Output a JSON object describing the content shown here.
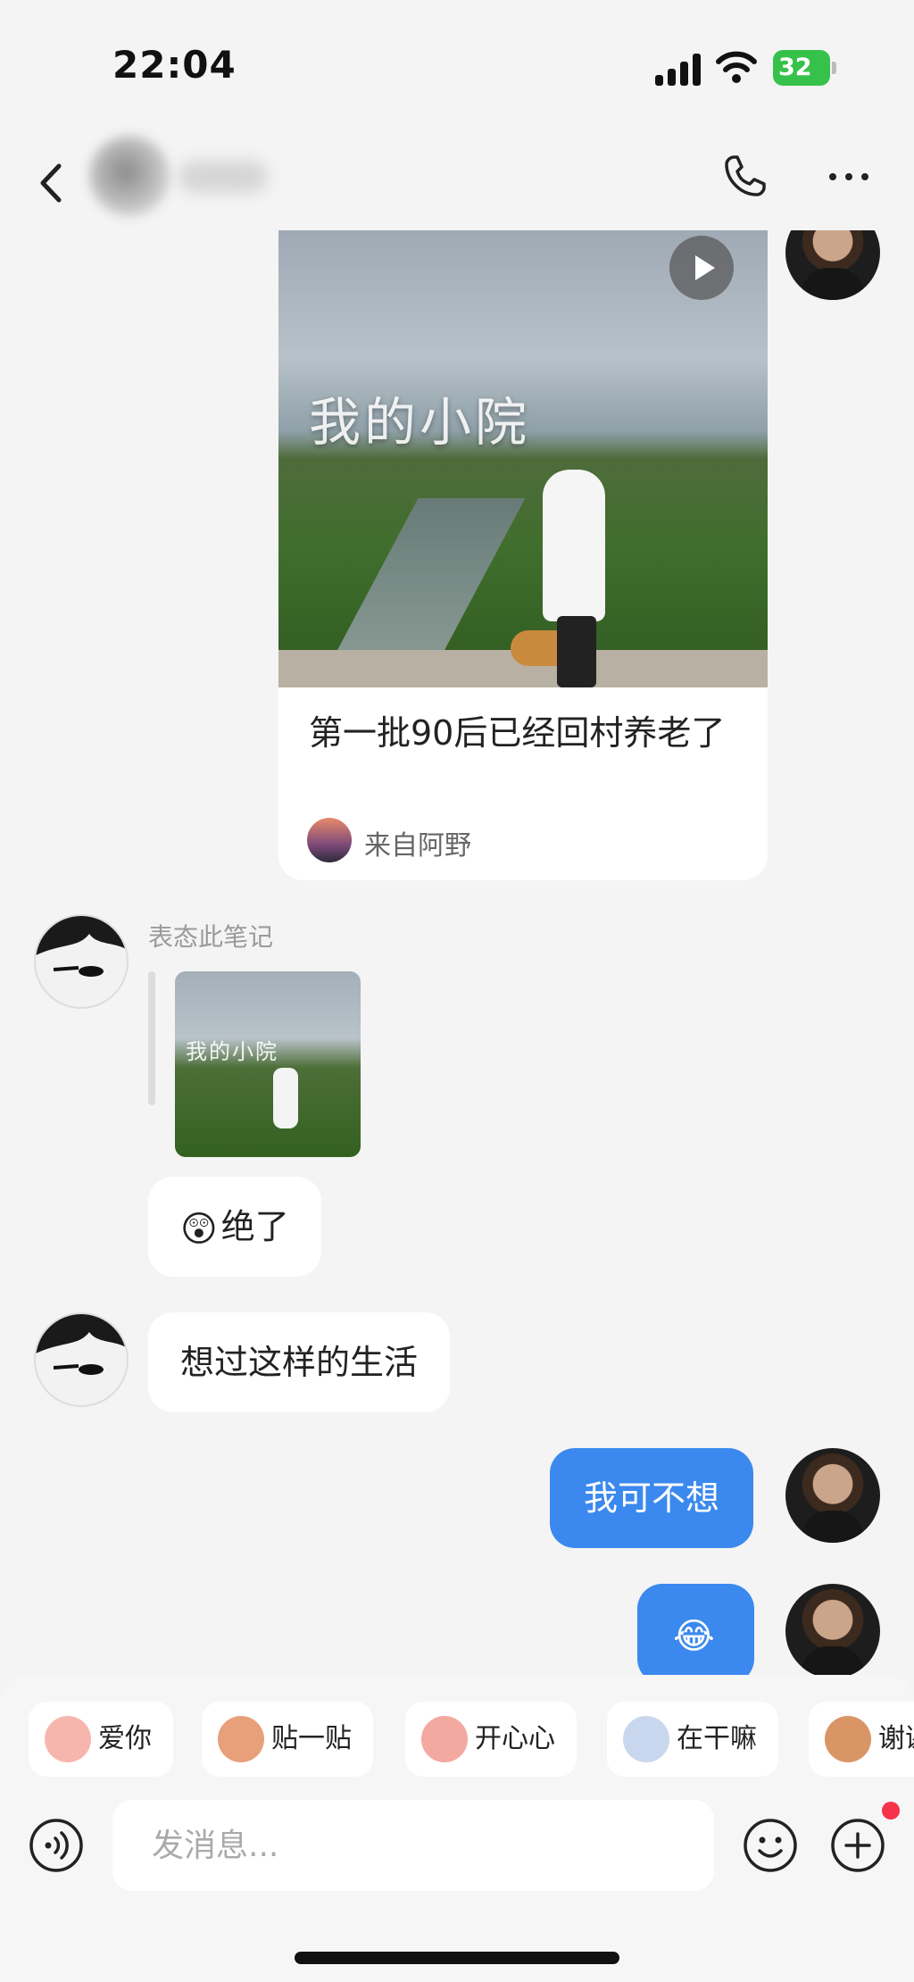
{
  "status_bar": {
    "time": "22:04",
    "battery": "32"
  },
  "card": {
    "image_title": "我的小院",
    "title": "第一批90后已经回村养老了",
    "source": "来自阿野"
  },
  "reaction": {
    "label": "表态此笔记",
    "thumb_title": "我的小院"
  },
  "messages": {
    "peer_emoji_text": "绝了",
    "peer_text": "想过这样的生活",
    "me_text": "我可不想",
    "me_emoji": "😂",
    "peer_emoji_glyph": "😲"
  },
  "stickers": [
    {
      "label": "爱你",
      "icon": "love-you-sticker-icon",
      "color": "#f7b6ad"
    },
    {
      "label": "贴一贴",
      "icon": "cuddle-sticker-icon",
      "color": "#e7a07a"
    },
    {
      "label": "开心心",
      "icon": "happy-sticker-icon",
      "color": "#f3a9a0"
    },
    {
      "label": "在干嘛",
      "icon": "whats-up-sticker-icon",
      "color": "#c9d7ee"
    },
    {
      "label": "谢谢",
      "icon": "thanks-sticker-icon",
      "color": "#d99566"
    }
  ],
  "composer": {
    "placeholder": "发消息..."
  },
  "colors": {
    "accent": "#3b89ee",
    "notify": "#f5334a",
    "battery": "#36c24a"
  }
}
